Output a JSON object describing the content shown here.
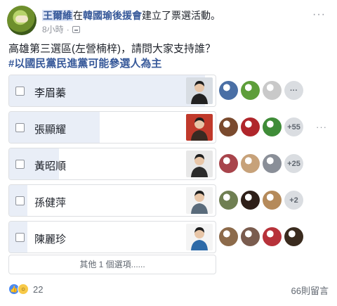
{
  "header": {
    "author": "王爾維",
    "action_prefix": "在",
    "group": "韓國瑜後援會",
    "action_suffix": "建立了票選活動。",
    "time": "8小時",
    "separator": "·",
    "more": "···"
  },
  "post": {
    "question": "高雄第三選區(左營楠梓)，請問大家支持誰？",
    "hashtag": "#以國民黨民進黨可能參選人為主"
  },
  "poll": {
    "options": [
      {
        "label": "李眉蓁",
        "fill": 0.95,
        "extra": "···",
        "voter_colors": [
          "#4a6fa5",
          "#5e9e3a",
          "#c9c9c9"
        ],
        "photo_bg": "#d8dde3",
        "photo_fg": "#222"
      },
      {
        "label": "張顯耀",
        "fill": 0.44,
        "extra": "+55",
        "voter_colors": [
          "#7a4a2e",
          "#b0262b",
          "#3f8c38"
        ],
        "photo_bg": "#c0392b",
        "photo_fg": "#3a2a22"
      },
      {
        "label": "黃昭順",
        "fill": 0.24,
        "extra": "+25",
        "voter_colors": [
          "#a8444b",
          "#c7a27a",
          "#8a8f98"
        ],
        "photo_bg": "#e8e8e8",
        "photo_fg": "#2b2b2b"
      },
      {
        "label": "孫健萍",
        "fill": 0.09,
        "extra": "+2",
        "voter_colors": [
          "#6f7f52",
          "#2e1f18",
          "#b58a5a"
        ],
        "photo_bg": "#f2f2f2",
        "photo_fg": "#5a6b7b"
      },
      {
        "label": "陳麗珍",
        "fill": 0.09,
        "extra": "",
        "voter_colors": [
          "#8c6a4a",
          "#7a5c4e",
          "#b7323a",
          "#3a2b1e"
        ],
        "photo_bg": "#f4f4f4",
        "photo_fg": "#2d6aa8"
      }
    ],
    "more_options": "其他 1 個選項......"
  },
  "footer": {
    "reaction_count": "22",
    "comments": "66則留言"
  },
  "icons": {
    "like": "like-icon",
    "wow": "wow-icon",
    "privacy": "group-icon",
    "more": "more-icon"
  }
}
